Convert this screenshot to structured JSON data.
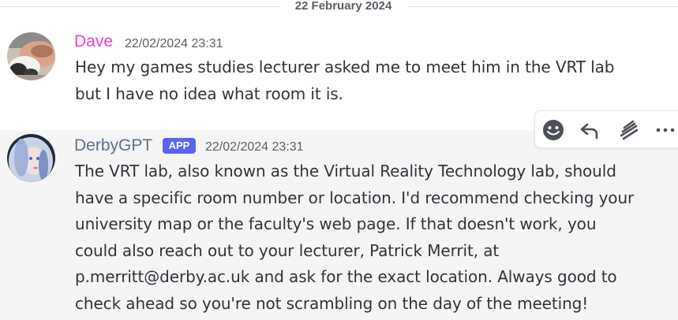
{
  "divider": {
    "date": "22 February 2024"
  },
  "messages": [
    {
      "author": "Dave",
      "timestamp": "22/02/2024 23:31",
      "text": "Hey my games studies lecturer asked me to meet him in the VRT lab\nbut I have no idea what room it is.",
      "author_color": "#f23bd6"
    },
    {
      "author": "DerbyGPT",
      "badge": "APP",
      "timestamp": "22/02/2024 23:31",
      "text": "The VRT lab, also known as the Virtual Reality Technology lab, should\nhave a specific room number or location. I'd recommend checking your\nuniversity map or the faculty's web page. If that doesn't work, you\ncould also reach out to your lecturer, Patrick Merrit, at\np.merritt@derby.ac.uk and ask for the exact location. Always good to\ncheck ahead so you're not scrambling on the day of the meeting!",
      "author_color": "#5f7187"
    }
  ],
  "toolbar": {
    "icons": [
      "add-reaction-icon",
      "reply-icon",
      "create-thread-icon",
      "more-icon"
    ]
  },
  "colors": {
    "badge": "#5865f2",
    "hover_background": "#f5f5f6"
  }
}
